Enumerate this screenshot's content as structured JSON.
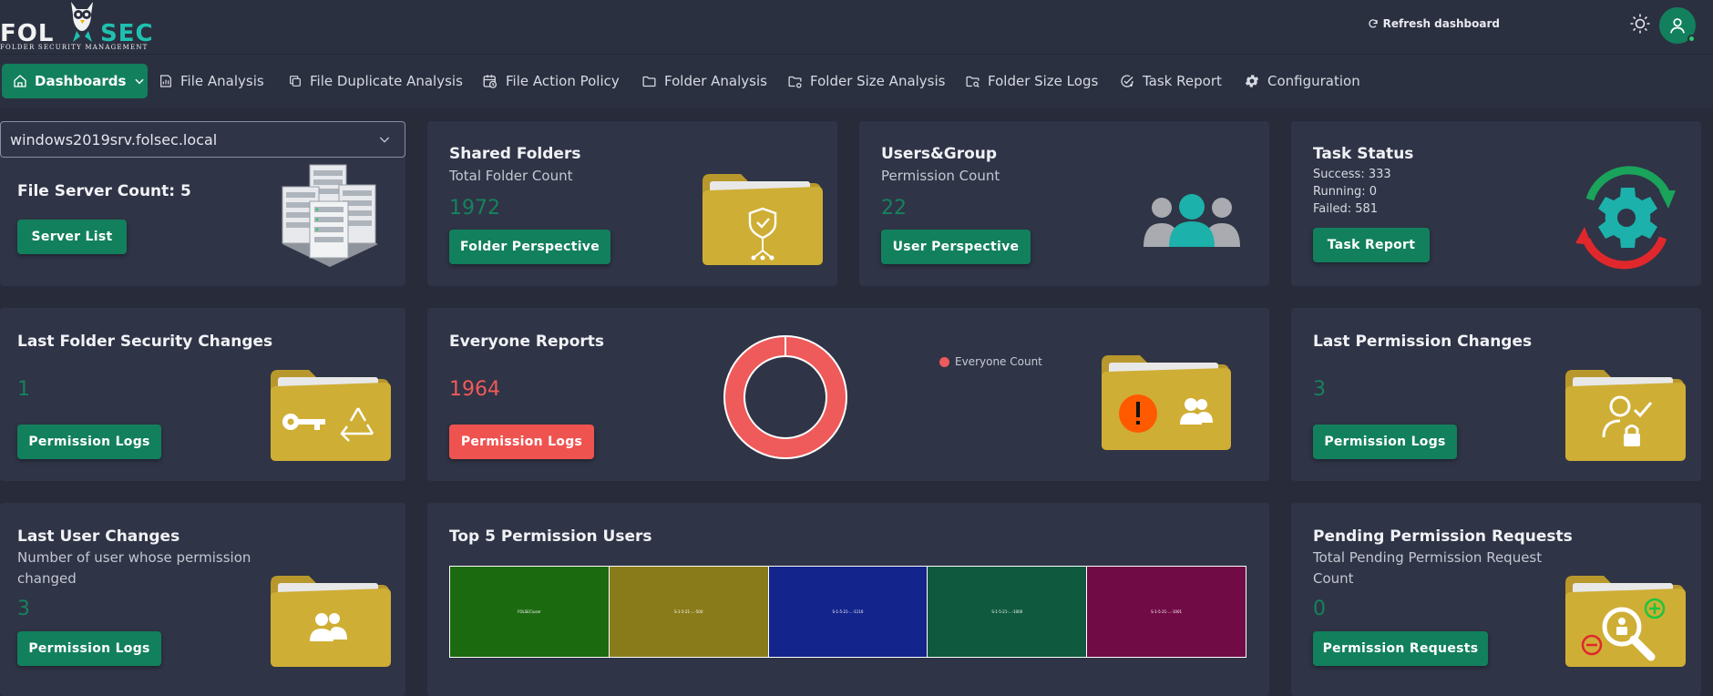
{
  "header": {
    "logo_text": "FOLSEC",
    "logo_subtitle": "FOLDER SECURITY MANAGEMENT",
    "refresh_label": "Refresh dashboard"
  },
  "nav": {
    "dashboards": "Dashboards",
    "items": [
      {
        "label": "File Analysis",
        "icon": "bar-chart-icon"
      },
      {
        "label": "File Duplicate Analysis",
        "icon": "copy-icon"
      },
      {
        "label": "File Action Policy",
        "icon": "calendar-clock-icon"
      },
      {
        "label": "Folder Analysis",
        "icon": "folder-icon"
      },
      {
        "label": "Folder Size Analysis",
        "icon": "folder-settings-icon"
      },
      {
        "label": "Folder Size Logs",
        "icon": "folder-search-icon"
      },
      {
        "label": "Task Report",
        "icon": "task-check-icon"
      },
      {
        "label": "Configuration",
        "icon": "gear-icon"
      }
    ]
  },
  "server_select": {
    "value": "windows2019srv.folsec.local"
  },
  "cards": {
    "file_server": {
      "title": "File Server Count: 5",
      "button": "Server List"
    },
    "shared_folders": {
      "title": "Shared Folders",
      "subtitle": "Total Folder Count",
      "value": "1972",
      "button": "Folder Perspective"
    },
    "users_group": {
      "title": "Users&Group",
      "subtitle": "Permission Count",
      "value": "22",
      "button": "User Perspective"
    },
    "task_status": {
      "title": "Task Status",
      "success": "Success: 333",
      "running": "Running: 0",
      "failed": "Failed: 581",
      "button": "Task Report"
    },
    "last_folder_security": {
      "title": "Last Folder Security Changes",
      "value": "1",
      "button": "Permission Logs"
    },
    "everyone_reports": {
      "title": "Everyone Reports",
      "value": "1964",
      "button": "Permission Logs",
      "legend": "Everyone Count"
    },
    "last_permission": {
      "title": "Last Permission Changes",
      "value": "3",
      "button": "Permission Logs"
    },
    "last_user": {
      "title": "Last User Changes",
      "subtitle": "Number of user whose permission changed",
      "value": "3",
      "button": "Permission Logs"
    },
    "top5": {
      "title": "Top 5 Permission Users"
    },
    "pending": {
      "title": "Pending Permission Requests",
      "subtitle": "Total Pending Permission Request Count",
      "value": "0",
      "button": "Permission Requests"
    }
  },
  "chart_data": [
    {
      "type": "pie",
      "title": "",
      "categories": [
        "Everyone Count"
      ],
      "values": [
        1964
      ],
      "colors": [
        "#ef5a5a"
      ],
      "legend": "top-right"
    },
    {
      "type": "heatmap",
      "title": "Top 5 Permission Users",
      "categories": [
        "FOLSEC\\user",
        "S-1-5-21-...-500",
        "S-1-5-21-...-1110",
        "S-1-5-21-...-1000",
        "S-1-5-21-...-1001"
      ],
      "colors": [
        "#1c6a0f",
        "#8a7b1a",
        "#13248c",
        "#0f5a3e",
        "#710b45"
      ]
    }
  ],
  "colors": {
    "accent": "#12805c",
    "danger": "#ef5350",
    "folder": "#cfae35",
    "background": "#272b3a",
    "card": "#2f3446"
  }
}
